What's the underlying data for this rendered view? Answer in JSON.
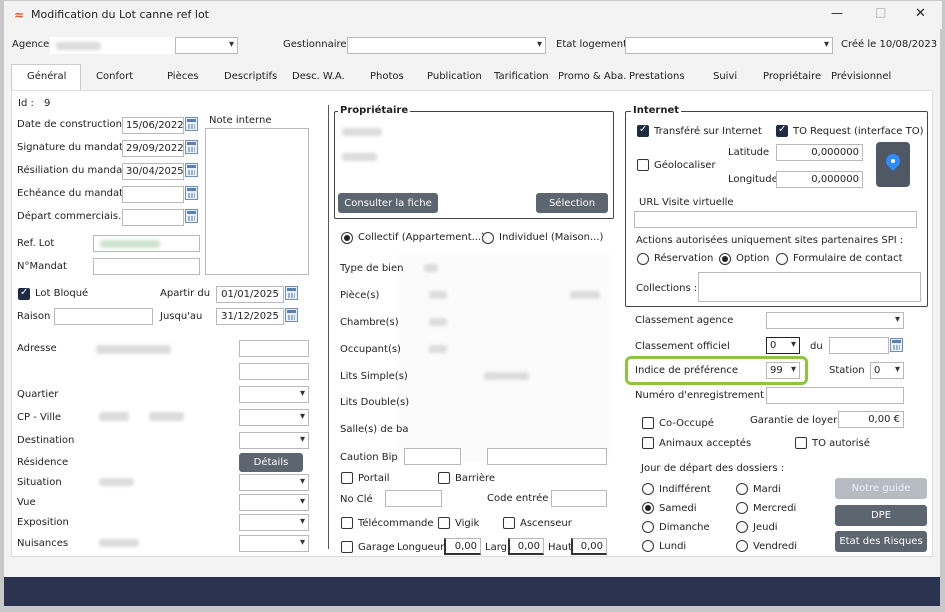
{
  "window": {
    "title": "Modification du Lot canne ref lot",
    "minimize": "—",
    "maximize": "□",
    "close": "✕"
  },
  "header": {
    "agence_label": "Agence",
    "gestionnaire_label": "Gestionnaire",
    "etat_label": "Etat logement",
    "created": "Créé le 10/08/2023"
  },
  "tabs": [
    "Général",
    "Confort",
    "Pièces",
    "Descriptifs",
    "Desc. W.A.",
    "Photos",
    "Publication",
    "Tarification",
    "Promo & Aba.",
    "Prestations",
    "Suivi",
    "Propriétaire",
    "Prévisionnel"
  ],
  "left": {
    "id_label": "Id :",
    "id_value": "9",
    "dates": [
      {
        "label": "Date de construction",
        "value": "15/06/2022"
      },
      {
        "label": "Signature du mandat",
        "value": "29/09/2022"
      },
      {
        "label": "Résiliation du mandat",
        "value": "30/04/2025"
      },
      {
        "label": "Echéance du mandat",
        "value": ""
      },
      {
        "label": "Départ commerciais.",
        "value": ""
      }
    ],
    "note_label": "Note interne",
    "ref_label": "Ref. Lot",
    "mandat_label": "N°Mandat",
    "bloque_label": "Lot Bloqué",
    "apartir_label": "Apartir du",
    "apartir_value": "01/01/2025",
    "raison_label": "Raison",
    "jusqu_label": "Jusqu'au",
    "jusqu_value": "31/12/2025",
    "addr_labels": [
      "Adresse",
      "Quartier",
      "CP - Ville",
      "Destination",
      "Résidence",
      "Situation",
      "Vue",
      "Exposition",
      "Nuisances"
    ],
    "details_btn": "Détails"
  },
  "middle": {
    "proprio_title": "Propriétaire",
    "consulter_btn": "Consulter la fiche",
    "selection_btn": "Sélection",
    "collectif": "Collectif (Appartement...)",
    "individuel": "Individuel (Maison...)",
    "rows": [
      "Type de bien",
      "Pièce(s)",
      "Chambre(s)",
      "Occupant(s)",
      "Lits Simple(s)",
      "Lits Double(s)",
      "Salle(s) de ba"
    ],
    "caution": "Caution Bip",
    "portail": "Portail",
    "barriere": "Barrière",
    "nocle": "No Clé",
    "code_entree": "Code entrée",
    "telecommande": "Télécommande",
    "vigik": "Vigik",
    "ascenseur": "Ascenseur",
    "garage": "Garage",
    "longueur": "Longueur",
    "longueur_v": "0,00",
    "larg": "Larg.",
    "larg_v": "0,00",
    "haut": "Haut.",
    "haut_v": "0,00"
  },
  "right": {
    "internet_title": "Internet",
    "transfere": "Transféré sur Internet",
    "to_request": "TO Request (interface TO)",
    "geoloc": "Géolocaliser",
    "latitude": "Latitude",
    "latitude_v": "0,000000",
    "longitude": "Longitude",
    "longitude_v": "0,000000",
    "url_label": "URL Visite virtuelle",
    "actions_label": "Actions autorisées uniquement sites partenaires SPI :",
    "reservation": "Réservation",
    "option": "Option",
    "formulaire": "Formulaire de contact",
    "collections": "Collections :",
    "classement_agence": "Classement agence",
    "classement_officiel": "Classement officiel",
    "classement_officiel_v": "0",
    "du": "du",
    "indice": "Indice de préférence",
    "indice_v": "99",
    "station": "Station",
    "station_v": "0",
    "numero": "Numéro d'enregistrement",
    "cooccupe": "Co-Occupé",
    "garantie": "Garantie de loyer",
    "garantie_v": "0,00 €",
    "animaux": "Animaux acceptés",
    "to_autorise": "TO autorisé",
    "jour_label": "Jour de départ des dossiers :",
    "days": [
      "Indifférent",
      "Mardi",
      "Samedi",
      "Mercredi",
      "Dimanche",
      "Jeudi",
      "Lundi",
      "Vendredi"
    ],
    "notre_guide": "Notre guide",
    "dpe": "DPE",
    "etat_risques": "Etat des Risques"
  },
  "colors": {
    "accent": "#5d6570",
    "highlight": "#8cc63f",
    "footer": "#2b3350"
  }
}
